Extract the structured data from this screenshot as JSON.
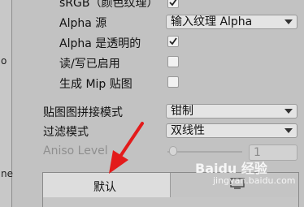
{
  "left_panel": {
    "fragments": [
      "o",
      "ne"
    ]
  },
  "rows": {
    "srgb_label": "sRGB（颜色纹理）",
    "alpha_source_label": "Alpha 源",
    "alpha_source_value": "输入纹理 Alpha",
    "alpha_transparent_label": "Alpha 是透明的",
    "read_write_label": "读/写已启用",
    "mipmap_label": "生成 Mip 贴图",
    "wrap_mode_label": "贴图图拼接模式",
    "wrap_mode_value": "钳制",
    "filter_mode_label": "过滤模式",
    "filter_mode_value": "双线性",
    "aniso_label": "Aniso Level",
    "aniso_value": "1"
  },
  "checkboxes": {
    "srgb": true,
    "alpha_transparent": true,
    "read_write": false,
    "mipmap": false
  },
  "aniso_slider_level": 0,
  "tabs": {
    "default_label": "默认"
  },
  "watermark": {
    "line1": "Baidu 经验",
    "line2": "jingyan.baidu.com"
  },
  "colors": {
    "arrow": "#e31b1b",
    "background": "#c2c2c2"
  }
}
